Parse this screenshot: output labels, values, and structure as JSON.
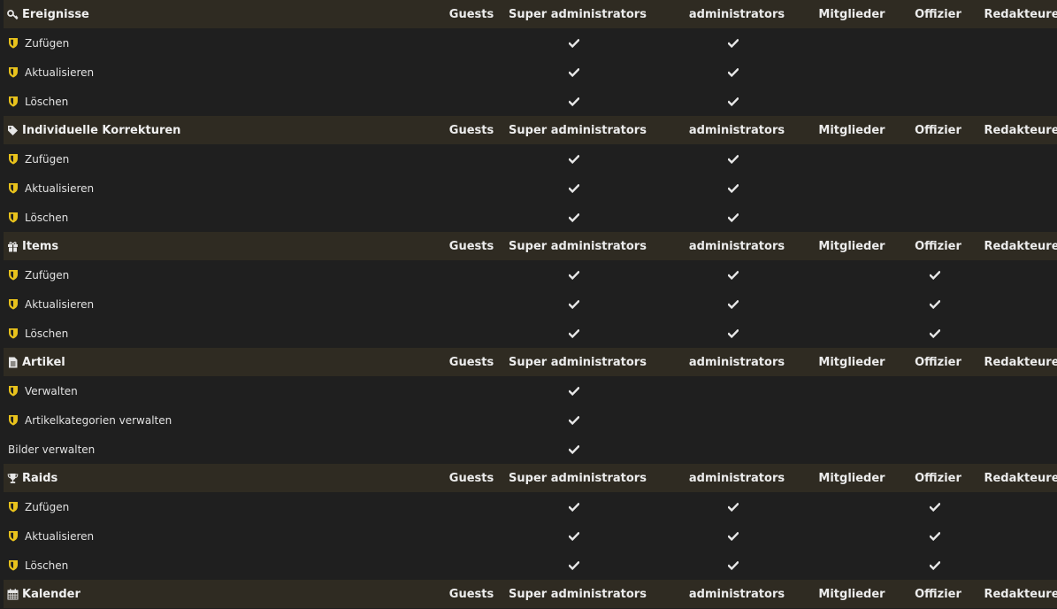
{
  "columns": [
    "Guests",
    "Super administrators",
    "administrators",
    "Mitglieder",
    "Offizier",
    "Redakteure"
  ],
  "colors": {
    "header_bg": "#2f2b22",
    "page_bg": "#1f1f1f",
    "shield": "#e8c21c",
    "check": "#e8e8e8"
  },
  "sections": [
    {
      "title": "Ereignisse",
      "icon": "key-icon",
      "rows": [
        {
          "label": "Zufügen",
          "icon": "shield-icon",
          "checks": [
            false,
            true,
            true,
            false,
            false,
            false
          ]
        },
        {
          "label": "Aktualisieren",
          "icon": "shield-icon",
          "checks": [
            false,
            true,
            true,
            false,
            false,
            false
          ]
        },
        {
          "label": "Löschen",
          "icon": "shield-icon",
          "checks": [
            false,
            true,
            true,
            false,
            false,
            false
          ]
        }
      ]
    },
    {
      "title": "Individuelle Korrekturen",
      "icon": "tag-icon",
      "rows": [
        {
          "label": "Zufügen",
          "icon": "shield-icon",
          "checks": [
            false,
            true,
            true,
            false,
            false,
            false
          ]
        },
        {
          "label": "Aktualisieren",
          "icon": "shield-icon",
          "checks": [
            false,
            true,
            true,
            false,
            false,
            false
          ]
        },
        {
          "label": "Löschen",
          "icon": "shield-icon",
          "checks": [
            false,
            true,
            true,
            false,
            false,
            false
          ]
        }
      ]
    },
    {
      "title": "Items",
      "icon": "gift-icon",
      "rows": [
        {
          "label": "Zufügen",
          "icon": "shield-icon",
          "checks": [
            false,
            true,
            true,
            false,
            true,
            false
          ]
        },
        {
          "label": "Aktualisieren",
          "icon": "shield-icon",
          "checks": [
            false,
            true,
            true,
            false,
            true,
            false
          ]
        },
        {
          "label": "Löschen",
          "icon": "shield-icon",
          "checks": [
            false,
            true,
            true,
            false,
            true,
            false
          ]
        }
      ]
    },
    {
      "title": "Artikel",
      "icon": "file-icon",
      "rows": [
        {
          "label": "Verwalten",
          "icon": "shield-icon",
          "checks": [
            false,
            true,
            false,
            false,
            false,
            false
          ]
        },
        {
          "label": "Artikelkategorien verwalten",
          "icon": "shield-icon",
          "checks": [
            false,
            true,
            false,
            false,
            false,
            false
          ]
        },
        {
          "label": "Bilder verwalten",
          "icon": "",
          "checks": [
            false,
            true,
            false,
            false,
            false,
            false
          ]
        }
      ]
    },
    {
      "title": "Raids",
      "icon": "trophy-icon",
      "rows": [
        {
          "label": "Zufügen",
          "icon": "shield-icon",
          "checks": [
            false,
            true,
            true,
            false,
            true,
            false
          ]
        },
        {
          "label": "Aktualisieren",
          "icon": "shield-icon",
          "checks": [
            false,
            true,
            true,
            false,
            true,
            false
          ]
        },
        {
          "label": "Löschen",
          "icon": "shield-icon",
          "checks": [
            false,
            true,
            true,
            false,
            true,
            false
          ]
        }
      ]
    },
    {
      "title": "Kalender",
      "icon": "calendar-icon",
      "rows": []
    }
  ]
}
